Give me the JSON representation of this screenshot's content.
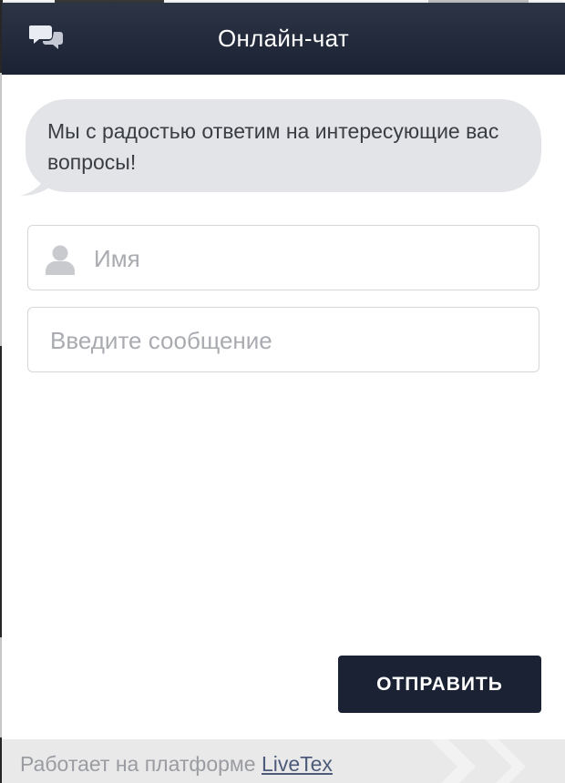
{
  "header": {
    "title": "Онлайн-чат",
    "icon": "chat-bubbles-icon"
  },
  "greeting": {
    "text": "Мы с радостью ответим на интересующие вас вопросы!"
  },
  "form": {
    "name_placeholder": "Имя",
    "name_value": "",
    "message_placeholder": "Введите сообщение",
    "message_value": "",
    "send_label": "ОТПРАВИТЬ"
  },
  "footer": {
    "text": "Работает на платформе",
    "link_label": "LiveTex"
  },
  "colors": {
    "header": "#1a2233",
    "button": "#1a2233",
    "bubble": "#e3e4e7",
    "footer_bg": "#e9e9ea"
  }
}
